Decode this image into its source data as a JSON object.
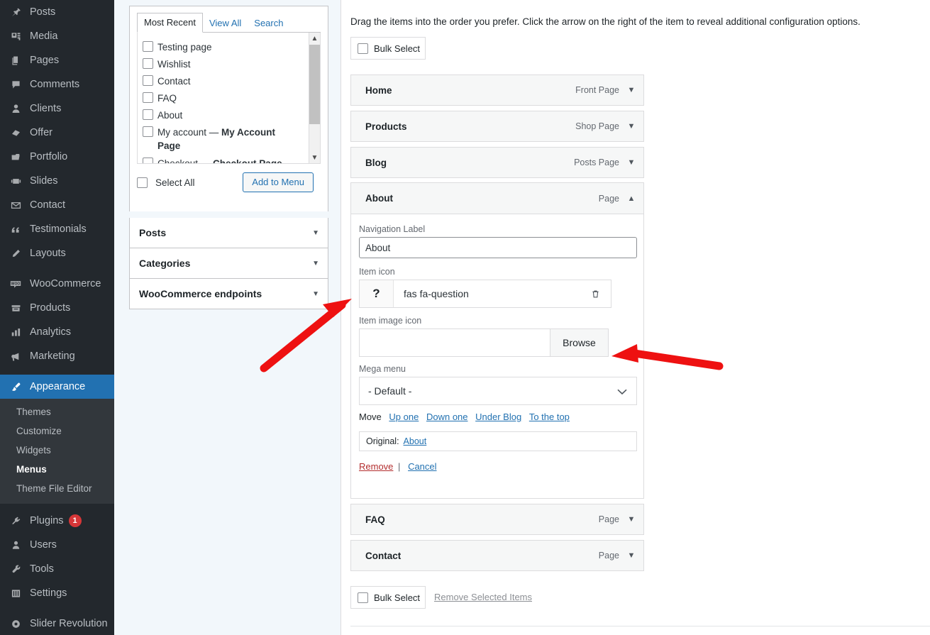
{
  "sidebar": {
    "items": [
      {
        "label": "Posts",
        "icon": "pin-icon"
      },
      {
        "label": "Media",
        "icon": "media-icon"
      },
      {
        "label": "Pages",
        "icon": "pages-icon"
      },
      {
        "label": "Comments",
        "icon": "comments-icon"
      },
      {
        "label": "Clients",
        "icon": "user-icon"
      },
      {
        "label": "Offer",
        "icon": "offer-icon"
      },
      {
        "label": "Portfolio",
        "icon": "portfolio-icon"
      },
      {
        "label": "Slides",
        "icon": "slides-icon"
      },
      {
        "label": "Contact",
        "icon": "envelope-icon"
      },
      {
        "label": "Testimonials",
        "icon": "quote-icon"
      },
      {
        "label": "Layouts",
        "icon": "pencil-icon"
      },
      {
        "label": "WooCommerce",
        "icon": "woo-icon"
      },
      {
        "label": "Products",
        "icon": "products-icon"
      },
      {
        "label": "Analytics",
        "icon": "chart-icon"
      },
      {
        "label": "Marketing",
        "icon": "megaphone-icon"
      },
      {
        "label": "Appearance",
        "icon": "brush-icon"
      },
      {
        "label": "Plugins",
        "icon": "plug-icon",
        "badge": "1"
      },
      {
        "label": "Users",
        "icon": "users-icon"
      },
      {
        "label": "Tools",
        "icon": "wrench-icon"
      },
      {
        "label": "Settings",
        "icon": "settings-icon"
      },
      {
        "label": "Slider Revolution",
        "icon": "slider-revolution-icon"
      }
    ],
    "appearance_submenu": [
      {
        "label": "Themes"
      },
      {
        "label": "Customize"
      },
      {
        "label": "Widgets"
      },
      {
        "label": "Menus"
      },
      {
        "label": "Theme File Editor"
      }
    ],
    "active_item": "Appearance",
    "active_submenu": "Menus",
    "accent_color": "#2271b1",
    "badge_color": "#d63638"
  },
  "pages_panel": {
    "tabs": [
      {
        "label": "Most Recent",
        "active": true
      },
      {
        "label": "View All",
        "active": false
      },
      {
        "label": "Search",
        "active": false
      }
    ],
    "items": [
      {
        "label": "Testing page",
        "checked": false
      },
      {
        "label": "Wishlist",
        "checked": false
      },
      {
        "label": "Contact",
        "checked": false
      },
      {
        "label": "FAQ",
        "checked": false
      },
      {
        "label": "About",
        "checked": false
      },
      {
        "label": "My account — My Account",
        "checked": false,
        "wrap": "Page"
      },
      {
        "label": "Checkout — Checkout Page",
        "checked": false
      }
    ],
    "select_all_label": "Select All",
    "add_to_menu_label": "Add to Menu"
  },
  "accordions": [
    {
      "label": "Posts"
    },
    {
      "label": "Categories"
    },
    {
      "label": "WooCommerce endpoints"
    }
  ],
  "main": {
    "hint": "Drag the items into the order you prefer. Click the arrow on the right of the item to reveal additional configuration options.",
    "bulk_select_label": "Bulk Select",
    "bulk_select_bottom_label": "Bulk Select",
    "remove_selected_label": "Remove Selected Items",
    "menu_items": [
      {
        "name": "Home",
        "meta": "Front Page",
        "expanded": false
      },
      {
        "name": "Products",
        "meta": "Shop Page",
        "expanded": false
      },
      {
        "name": "Blog",
        "meta": "Posts Page",
        "expanded": false
      },
      {
        "name": "About",
        "meta": "Page",
        "expanded": true
      },
      {
        "name": "FAQ",
        "meta": "Page",
        "expanded": false
      },
      {
        "name": "Contact",
        "meta": "Page",
        "expanded": false
      }
    ],
    "expanded_item": {
      "title": "About",
      "meta": "Page",
      "nav_label_field_label": "Navigation Label",
      "nav_label_value": "About",
      "item_icon_label": "Item icon",
      "item_icon_glyph": "?",
      "item_icon_value": "fas fa-question",
      "delete_icon_name": "trash-icon",
      "item_image_icon_label": "Item image icon",
      "item_image_icon_value": "",
      "browse_label": "Browse",
      "mega_menu_label": "Mega menu",
      "mega_menu_value": "- Default -",
      "mega_menu_options": [
        "- Default -"
      ],
      "move_label": "Move",
      "move_links": [
        "Up one",
        "Down one",
        "Under Blog",
        "To the top"
      ],
      "original_label": "Original:",
      "original_link": "About",
      "remove_label": "Remove",
      "separator": "|",
      "cancel_label": "Cancel"
    }
  },
  "annotations": {
    "arrow_color": "#ee1111",
    "arrows": [
      {
        "name": "arrow-to-item-icon",
        "points_to": "item-icon-field"
      },
      {
        "name": "arrow-to-browse-button",
        "points_to": "browse-button"
      }
    ]
  }
}
